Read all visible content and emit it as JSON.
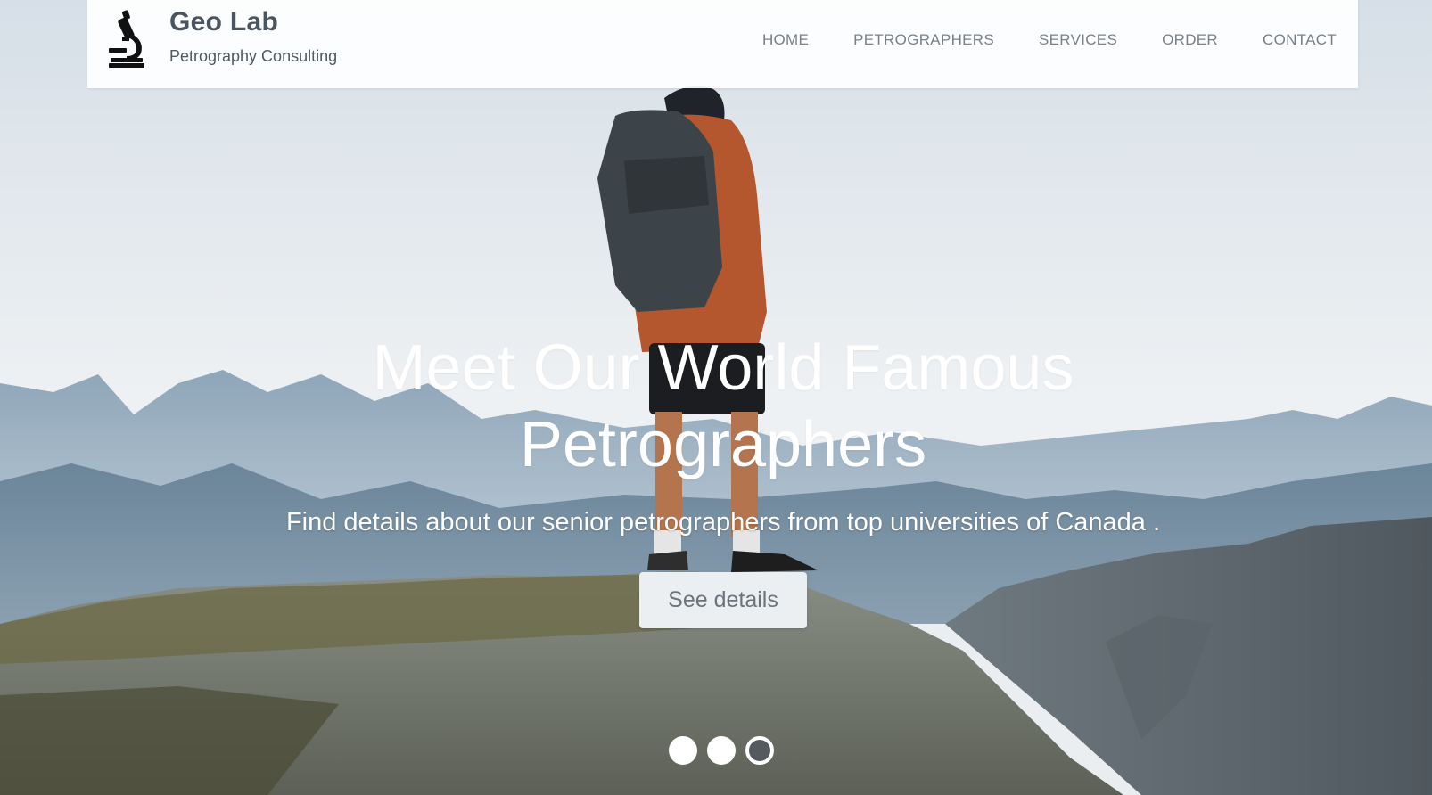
{
  "header": {
    "brand_name": "Geo Lab",
    "tagline": "Petrography Consulting",
    "logo_icon": "microscope-icon",
    "nav": [
      {
        "label": "HOME"
      },
      {
        "label": "PETROGRAPHERS"
      },
      {
        "label": "SERVICES"
      },
      {
        "label": "ORDER"
      },
      {
        "label": "CONTACT"
      }
    ]
  },
  "hero": {
    "title_line1": "Meet Our World Famous",
    "title_line2": "Petrographers",
    "subtitle": "Find details about our senior petrographers from top universities of Canada .",
    "button_label": "See details",
    "background": "photo of a hiker with backpack standing on a rocky mountain summit",
    "carousel": {
      "slides": 3,
      "active_index": 2
    }
  },
  "colors": {
    "header_bg": "#ffffff",
    "brand_text": "#4a5560",
    "nav_text": "#7a8087",
    "hero_text": "#ffffff",
    "button_bg": "#eceff2",
    "button_text": "#6c737a"
  }
}
